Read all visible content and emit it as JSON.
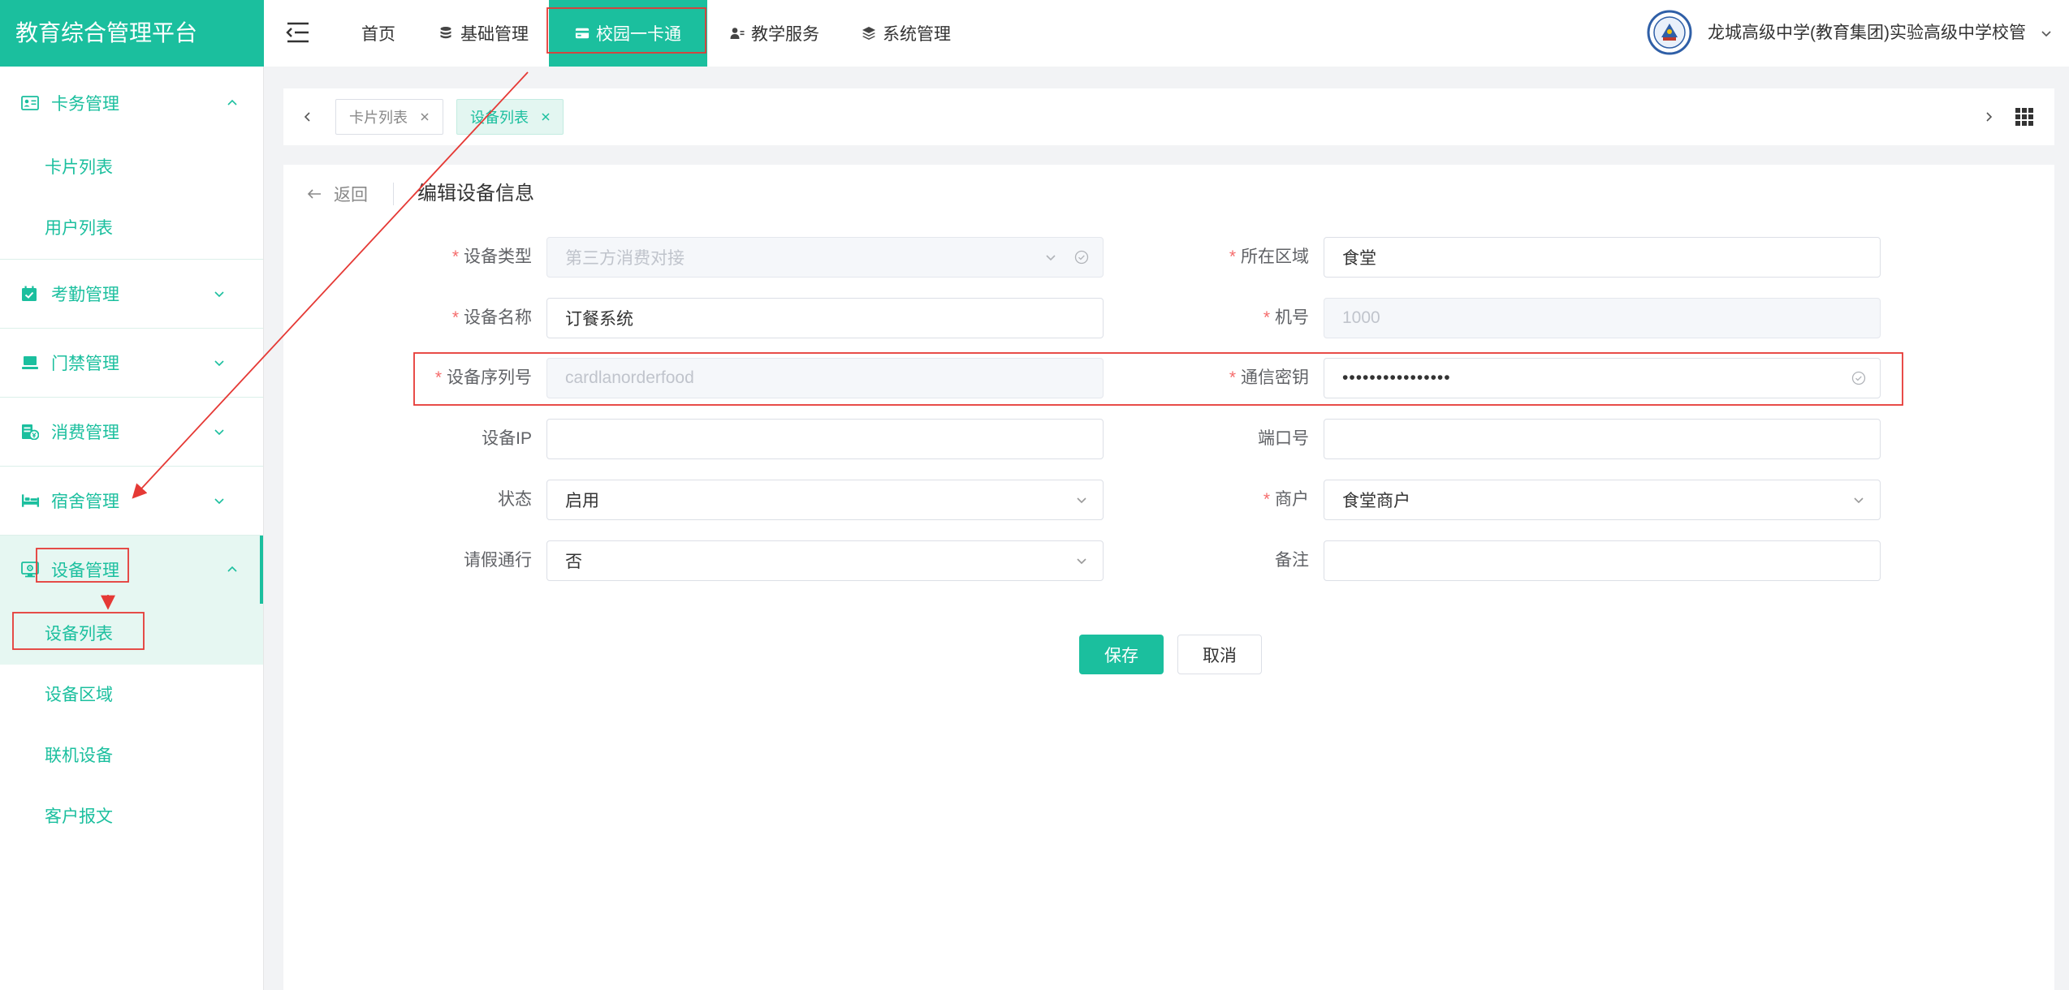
{
  "app": {
    "title": "教育综合管理平台"
  },
  "topnav": {
    "items": [
      {
        "label": "首页",
        "icon": null,
        "active": false
      },
      {
        "label": "基础管理",
        "icon": "database-icon",
        "active": false
      },
      {
        "label": "校园一卡通",
        "icon": "card-icon",
        "active": true
      },
      {
        "label": "教学服务",
        "icon": "teacher-icon",
        "active": false
      },
      {
        "label": "系统管理",
        "icon": "layers-icon",
        "active": false
      }
    ],
    "school": {
      "name": "龙城高级中学(教育集团)实验高级中学校管",
      "logo": "school-emblem-icon"
    }
  },
  "sidebar": {
    "groups": [
      {
        "label": "卡务管理",
        "icon": "id-card-icon",
        "expanded": true,
        "items": [
          "卡片列表",
          "用户列表"
        ]
      },
      {
        "label": "考勤管理",
        "icon": "calendar-check-icon",
        "expanded": false
      },
      {
        "label": "门禁管理",
        "icon": "monitor-icon",
        "expanded": false
      },
      {
        "label": "消费管理",
        "icon": "bill-icon",
        "expanded": false
      },
      {
        "label": "宿舍管理",
        "icon": "bed-icon",
        "expanded": false
      },
      {
        "label": "设备管理",
        "icon": "device-icon",
        "expanded": true,
        "active": true,
        "items": [
          "设备列表",
          "设备区域",
          "联机设备",
          "客户报文"
        ],
        "active_item": "设备列表"
      }
    ]
  },
  "tabs": {
    "items": [
      {
        "label": "卡片列表",
        "active": false
      },
      {
        "label": "设备列表",
        "active": true
      }
    ]
  },
  "page": {
    "back_label": "返回",
    "title": "编辑设备信息"
  },
  "form": {
    "required_mark": "*",
    "device_type": {
      "label": "设备类型",
      "value": "第三方消费对接",
      "required": true,
      "disabled": true
    },
    "area": {
      "label": "所在区域",
      "value": "食堂",
      "required": true
    },
    "device_name": {
      "label": "设备名称",
      "value": "订餐系统",
      "required": true
    },
    "machine_no": {
      "label": "机号",
      "value": "1000",
      "required": true,
      "disabled": true
    },
    "serial_no": {
      "label": "设备序列号",
      "value": "cardlanorderfood",
      "required": true,
      "disabled": true
    },
    "comm_key": {
      "label": "通信密钥",
      "value": "••••••••••••••••",
      "required": true,
      "masked": true
    },
    "device_ip": {
      "label": "设备IP",
      "value": ""
    },
    "port": {
      "label": "端口号",
      "value": ""
    },
    "status": {
      "label": "状态",
      "value": "启用"
    },
    "merchant": {
      "label": "商户",
      "value": "食堂商户",
      "required": true
    },
    "leave_pass": {
      "label": "请假通行",
      "value": "否"
    },
    "remark": {
      "label": "备注",
      "value": ""
    }
  },
  "actions": {
    "save_label": "保存",
    "cancel_label": "取消"
  },
  "colors": {
    "primary": "#1bbf9e",
    "active_bg": "#e6f7f2",
    "required_mark": "#f56c6c",
    "annotation": "#e53935"
  }
}
